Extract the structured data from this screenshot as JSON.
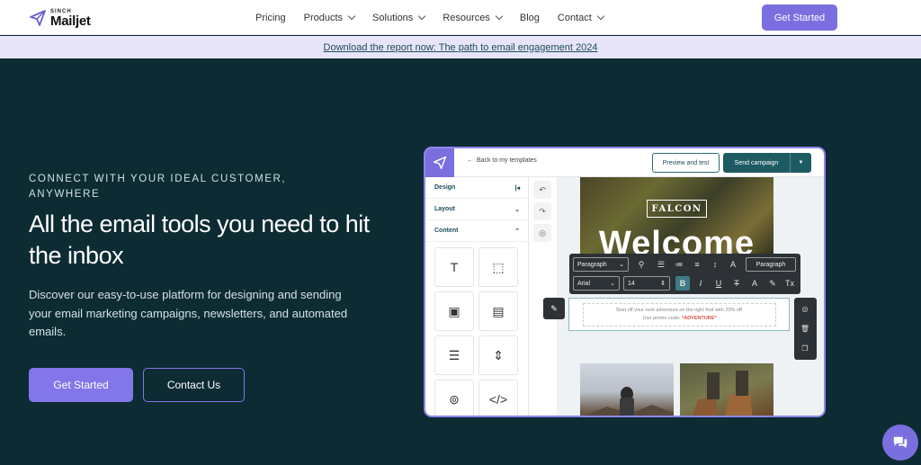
{
  "nav": {
    "logo_small": "SINCH",
    "logo_main": "Mailjet",
    "items": [
      {
        "label": "Pricing",
        "has_dropdown": false
      },
      {
        "label": "Products",
        "has_dropdown": true
      },
      {
        "label": "Solutions",
        "has_dropdown": true
      },
      {
        "label": "Resources",
        "has_dropdown": true
      },
      {
        "label": "Blog",
        "has_dropdown": false
      },
      {
        "label": "Contact",
        "has_dropdown": true
      }
    ],
    "cta": "Get Started"
  },
  "banner": {
    "link_text": "Download the report now: The path to email engagement 2024"
  },
  "hero": {
    "eyebrow": "CONNECT WITH YOUR IDEAL CUSTOMER, ANYWHERE",
    "headline": "All the email tools you need to hit the inbox",
    "subcopy": "Discover our easy-to-use platform for designing and sending your email marketing campaigns, newsletters, and automated emails.",
    "primary_button": "Get Started",
    "secondary_button": "Contact Us"
  },
  "editor": {
    "back_link": "Back to my templates",
    "preview_button": "Preview and test",
    "send_button": "Send campaign",
    "sidebar": {
      "design": "Design",
      "layout": "Layout",
      "content": "Content"
    },
    "brand_badge": "FALCON",
    "welcome_text": "Welcome",
    "toolbar": {
      "paragraph_select": "Paragraph",
      "paragraph_right": "Paragraph",
      "font_select": "Arial",
      "size_value": "14"
    },
    "text_block": {
      "line1": "Start off your next adventure on the right foot with 20% off.",
      "line2_prefix": "Use promo code:",
      "promo_code": "*ADVENTURE*"
    }
  },
  "colors": {
    "background": "#0d2b33",
    "accent": "#7b6fe0",
    "banner": "#e8e5fb",
    "editor_dark": "#2d3236",
    "teal": "#1d5b63"
  }
}
